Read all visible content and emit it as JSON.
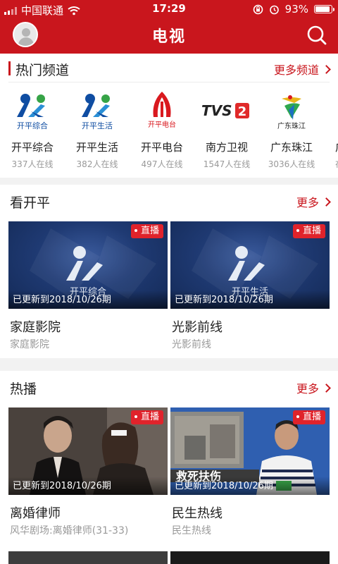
{
  "status_bar": {
    "carrier": "中国联通",
    "time": "17:29",
    "battery": "93%",
    "battery_level": 0.93
  },
  "nav": {
    "title": "电视",
    "avatar_icon": "user-avatar-icon",
    "search_icon": "search-icon"
  },
  "hot_channels": {
    "title": "热门频道",
    "more": "更多频道",
    "items": [
      {
        "name": "开平综合",
        "count": "337人在线",
        "logo_text": "开平综合"
      },
      {
        "name": "开平生活",
        "count": "382人在线",
        "logo_text": "开平生活"
      },
      {
        "name": "开平电台",
        "count": "497人在线",
        "logo_text": "开平电台"
      },
      {
        "name": "南方卫视",
        "count": "1547人在线",
        "logo_text": "TVS2"
      },
      {
        "name": "广东珠江",
        "count": "3036人在线",
        "logo_text": "广东珠江"
      },
      {
        "name": "广",
        "count": "在"
      }
    ]
  },
  "watch_kaiping": {
    "title": "看开平",
    "more": "更多",
    "cards": [
      {
        "title": "家庭影院",
        "subtitle": "家庭影院",
        "badge": "直播",
        "updated": "已更新到2018/10/26期",
        "logo_caption": "开平综合"
      },
      {
        "title": "光影前线",
        "subtitle": "光影前线",
        "badge": "直播",
        "updated": "已更新到2018/10/26期",
        "logo_caption": "开平生活"
      }
    ]
  },
  "hot_play": {
    "title": "热播",
    "more": "更多",
    "cards": [
      {
        "title": "离婚律师",
        "subtitle": "风华剧场:离婚律师(31-33)",
        "badge": "直播",
        "updated": "已更新到2018/10/26期"
      },
      {
        "title": "民生热线",
        "subtitle": "民生热线",
        "badge": "直播",
        "updated": "已更新到2018/10/26期",
        "overlay_text": "救死扶伤"
      }
    ]
  },
  "colors": {
    "brand_red": "#c9161d",
    "badge_red": "#e0232b"
  }
}
